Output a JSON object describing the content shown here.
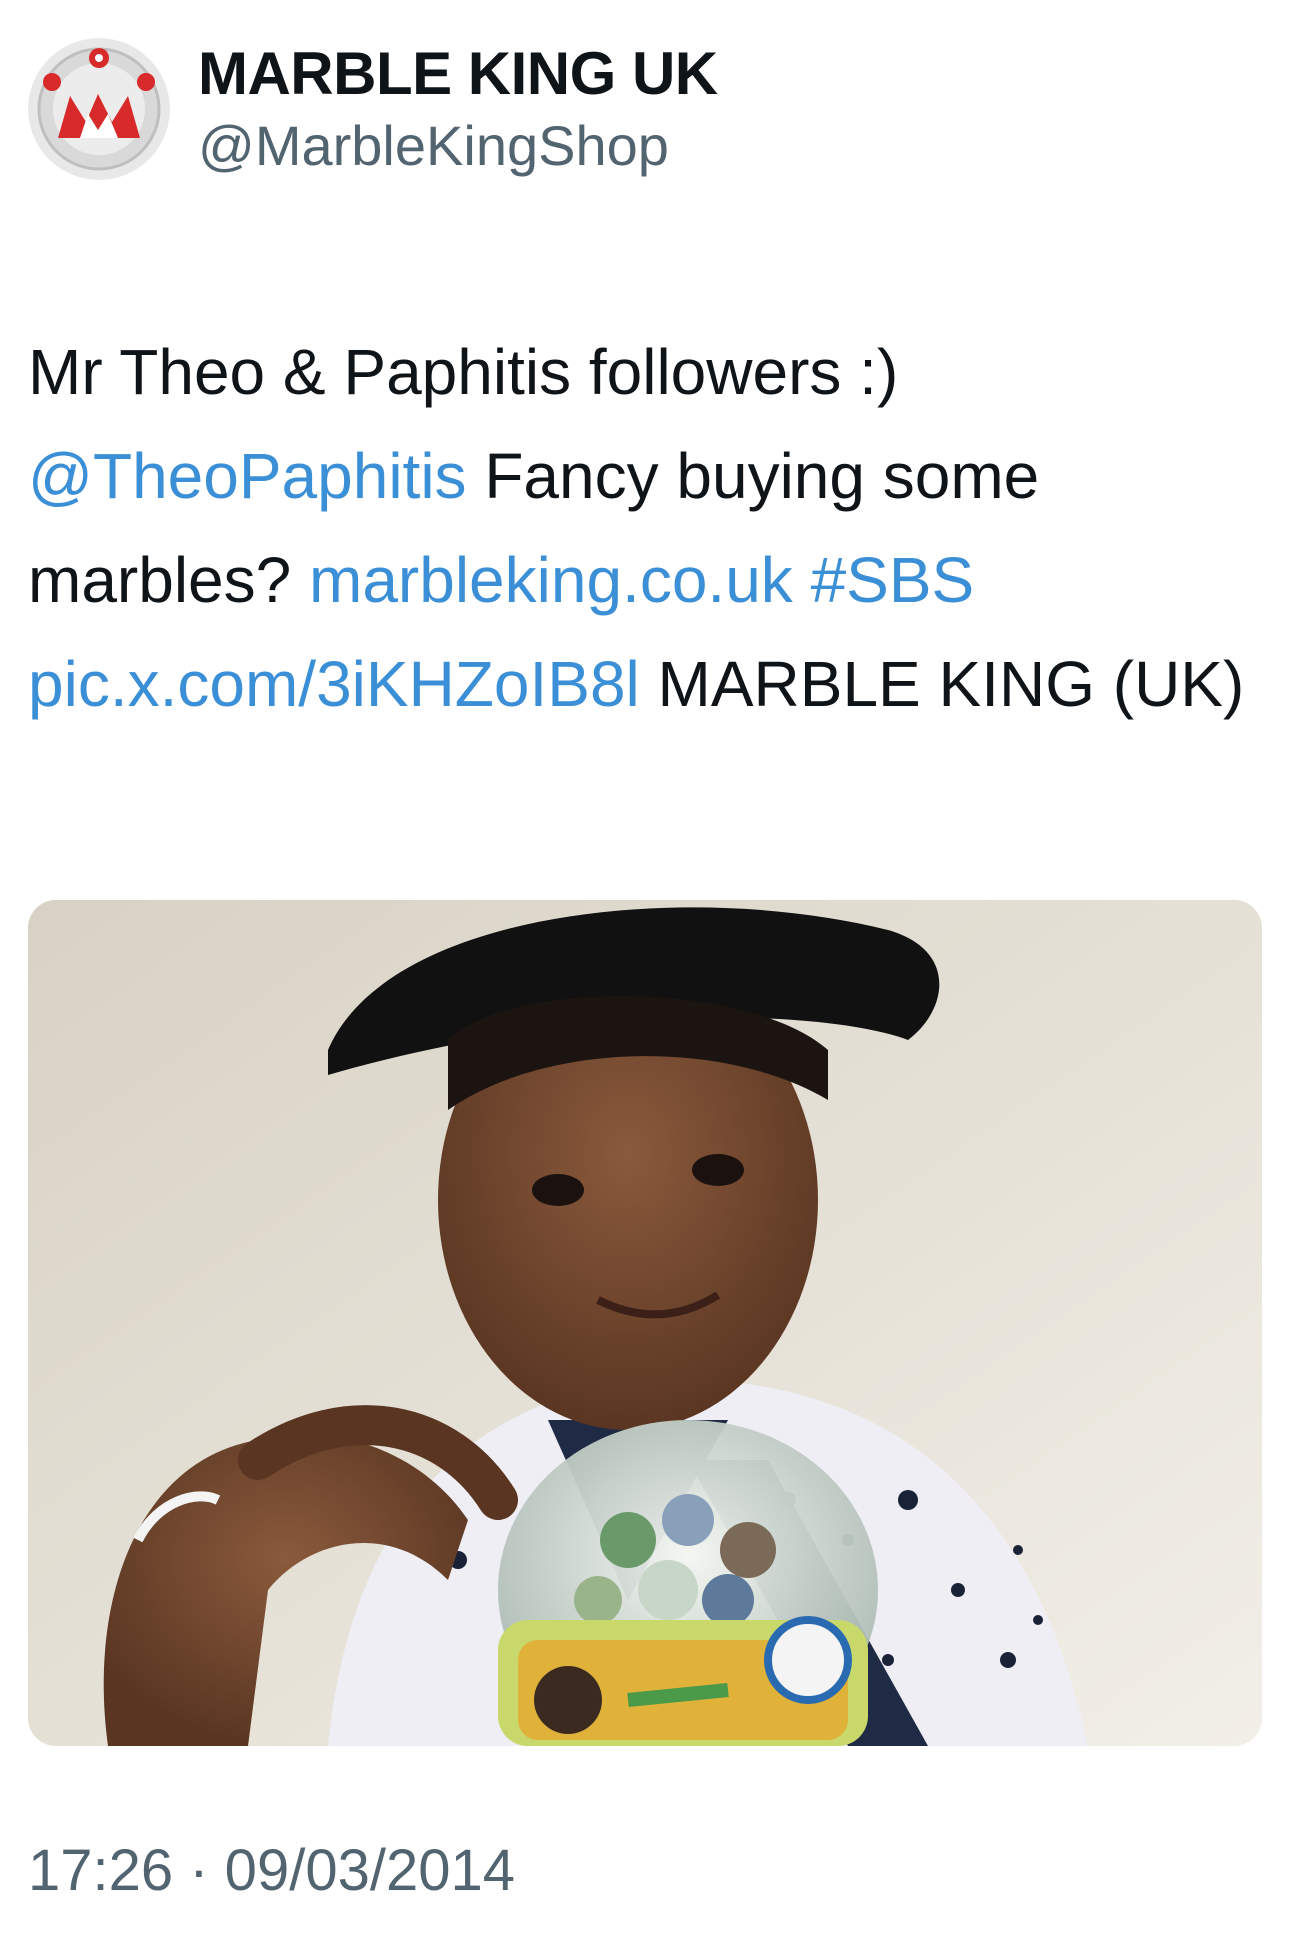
{
  "author": {
    "display_name": "MARBLE KING UK",
    "handle": "@MarbleKingShop",
    "avatar_icon": "marble-king-logo-icon"
  },
  "tweet": {
    "text_1": "Mr Theo & Paphitis followers :)",
    "mention": "@TheoPaphitis",
    "text_2": " Fancy buying some marbles? ",
    "link": "marbleking.co.uk",
    "hashtag": "#SBS",
    "media_link": "pic.x.com/3iKHZoIB8l",
    "text_3": " MARBLE KING (UK)"
  },
  "media": {
    "kind": "photo",
    "subject": "boy in black cap pointing at jar of marbles"
  },
  "meta": {
    "timestamp": "17:26 · 09/03/2014"
  },
  "colors": {
    "text": "#0f1419",
    "secondary": "#536471",
    "link": "#3b8fd6",
    "brand_red": "#d82a2a"
  }
}
